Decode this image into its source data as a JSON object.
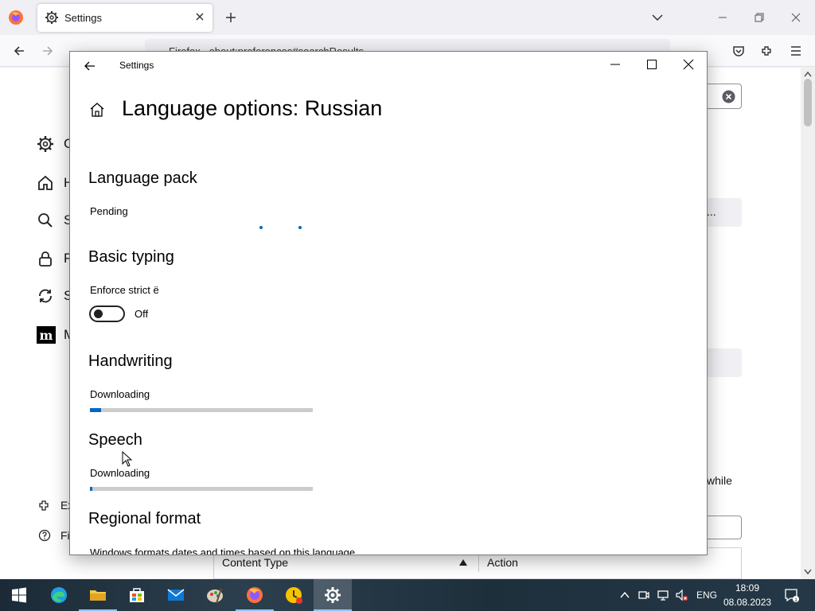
{
  "browser": {
    "tab_title": "Settings",
    "url_prefix": "Firefox",
    "url_text": "about:preferences#searchResults",
    "sidebar": [
      {
        "label": "G",
        "icon": "gear-icon"
      },
      {
        "label": "H",
        "icon": "home-icon"
      },
      {
        "label": "S",
        "icon": "search-icon"
      },
      {
        "label": "P",
        "icon": "lock-icon"
      },
      {
        "label": "S",
        "icon": "sync-icon"
      },
      {
        "label": "M",
        "icon": "mozilla-icon"
      }
    ],
    "sidebar_bottom": [
      {
        "label": "Ex",
        "icon": "puzzle-icon"
      },
      {
        "label": "Fi",
        "icon": "help-icon"
      }
    ],
    "box1_text": "...",
    "while_text": "while",
    "table_headers": [
      "Content Type",
      "Action"
    ]
  },
  "settings": {
    "window_title": "Settings",
    "page_title": "Language options: Russian",
    "sections": {
      "language_pack": {
        "heading": "Language pack",
        "status": "Pending"
      },
      "basic_typing": {
        "heading": "Basic typing",
        "option_label": "Enforce strict ё",
        "toggle_state": "Off",
        "toggle_on": false
      },
      "handwriting": {
        "heading": "Handwriting",
        "status": "Downloading",
        "progress": 0.05
      },
      "speech": {
        "heading": "Speech",
        "status": "Downloading",
        "progress": 0.01
      },
      "regional_format": {
        "heading": "Regional format",
        "description": "Windows formats dates and times based on this language"
      }
    }
  },
  "taskbar": {
    "apps": [
      "start-icon",
      "edge-icon",
      "file-explorer-icon",
      "store-icon",
      "mail-icon",
      "paint-icon",
      "firefox-icon",
      "app-icon",
      "settings-icon"
    ],
    "active_app": "settings-icon",
    "language": "ENG",
    "time": "18:09",
    "date": "08.08.2023"
  },
  "colors": {
    "accent": "#0067c0",
    "taskbar": "#1b2a36"
  }
}
